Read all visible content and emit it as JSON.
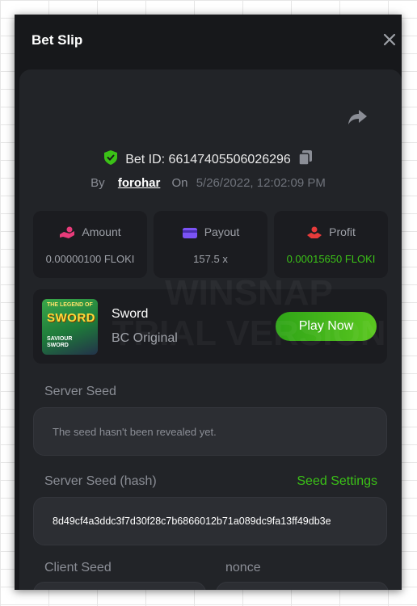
{
  "header": {
    "title": "Bet Slip"
  },
  "bet": {
    "id_label": "Bet ID: 66147405506026296",
    "by_label": "By",
    "user": "forohar",
    "on_label": "On",
    "date": "5/26/2022, 12:02:09 PM"
  },
  "stats": [
    {
      "label": "Amount",
      "value": "0.00000100 FLOKI"
    },
    {
      "label": "Payout",
      "value": "157.5 x"
    },
    {
      "label": "Profit",
      "value": "0.00015650 FLOKI"
    }
  ],
  "game": {
    "name": "Sword",
    "subtitle": "BC Original",
    "play_label": "Play Now",
    "thumb": {
      "line1": "THE LEGEND OF",
      "line2": "SWORD",
      "line3": "SAVIOUR\nSWORD"
    }
  },
  "server_seed": {
    "label": "Server Seed",
    "value": "The seed hasn't been revealed yet."
  },
  "server_seed_hash": {
    "label": "Server Seed (hash)",
    "settings_label": "Seed Settings",
    "value": "8d49cf4a3ddc3f7d30f28c7b6866012b71a089dc9fa13ff49db3e"
  },
  "client_seed": {
    "label": "Client Seed"
  },
  "nonce": {
    "label": "nonce"
  },
  "watermark": {
    "line1": "WINSNAP",
    "line2": "TRIAL VERSION"
  },
  "colors": {
    "accent_green": "#3bc117",
    "panel_bg": "#222428",
    "card_bg": "#1b1c20",
    "amount_icon": "#e83b7a",
    "payout_icon": "#7b53f5",
    "profit_icon": "#e83b3b"
  },
  "icons": {
    "close": "close-icon",
    "share": "share-arrow-icon",
    "verified": "shield-check-icon",
    "copy": "copy-icon",
    "amount": "hand-coin-icon",
    "payout": "wallet-card-icon",
    "profit": "profit-hand-icon"
  }
}
